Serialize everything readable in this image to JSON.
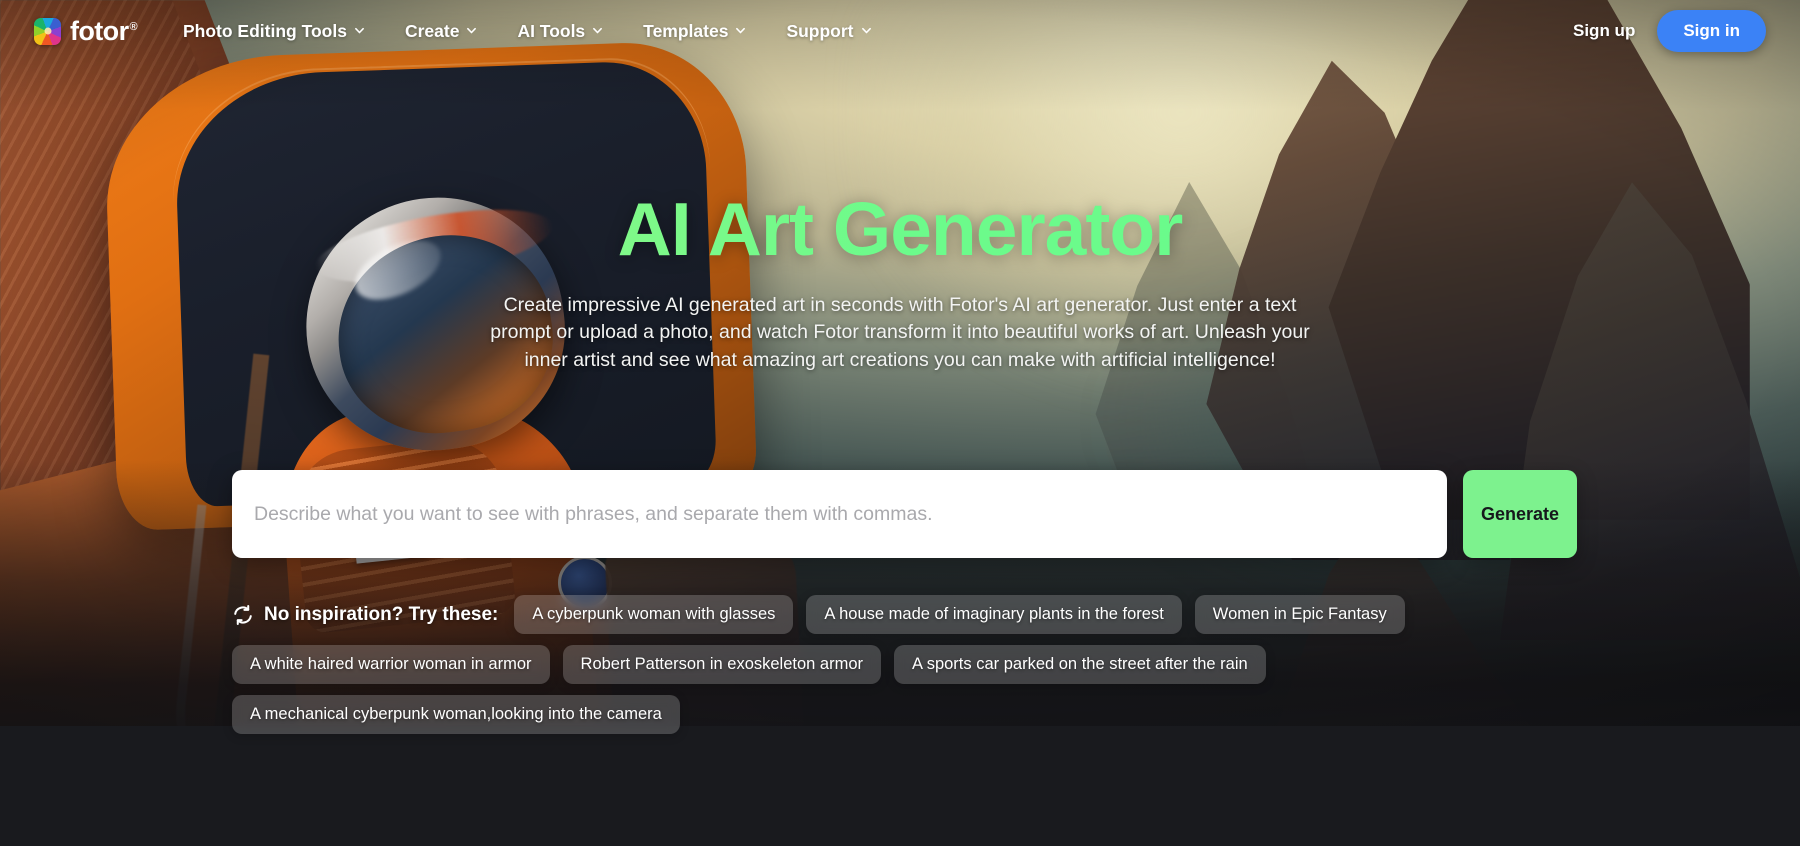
{
  "navbar": {
    "logo": {
      "text": "fotor",
      "registered_mark": "®",
      "icon": "fotor-pinwheel-icon"
    },
    "links": [
      {
        "label": "Photo Editing Tools",
        "has_dropdown": true
      },
      {
        "label": "Create",
        "has_dropdown": true
      },
      {
        "label": "AI Tools",
        "has_dropdown": true
      },
      {
        "label": "Templates",
        "has_dropdown": true
      },
      {
        "label": "Support",
        "has_dropdown": true
      }
    ],
    "sign_up": "Sign up",
    "sign_in": "Sign in",
    "sign_in_color": "#3b82f6"
  },
  "hero": {
    "title": "AI Art Generator",
    "title_gradient_from": "#d8f27c",
    "title_gradient_to": "#67fb8c",
    "description": "Create impressive AI generated art in seconds with Fotor's AI art generator. Just enter a text prompt or upload a photo, and watch Fotor transform it into beautiful works of art. Unleash your inner artist and see what amazing art creations you can make with artificial intelligence!"
  },
  "prompt": {
    "value": "",
    "placeholder": "Describe what you want to see with phrases, and separate them with commas.",
    "generate_label": "Generate",
    "generate_color": "#7df28e"
  },
  "inspiration": {
    "label": "No inspiration? Try these:",
    "refresh_icon": "refresh-icon",
    "tags": [
      "A cyberpunk woman with glasses",
      "A house made of imaginary plants in the forest",
      "Women in Epic Fantasy",
      "A white haired warrior woman in armor",
      "Robert Patterson in exoskeleton armor",
      "A sports car parked on the street after the rain",
      "A mechanical cyberpunk woman,looking into the camera"
    ]
  }
}
